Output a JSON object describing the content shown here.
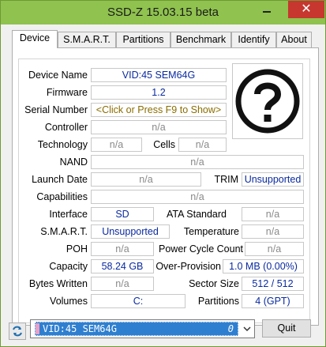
{
  "window": {
    "title": "SSD-Z 15.03.15 beta",
    "close_glyph": "✕",
    "accent": "#8fc24e",
    "close_color": "#c7372f"
  },
  "tabs": [
    {
      "label": "Device",
      "active": true
    },
    {
      "label": "S.M.A.R.T.",
      "active": false
    },
    {
      "label": "Partitions",
      "active": false
    },
    {
      "label": "Benchmark",
      "active": false
    },
    {
      "label": "Identify",
      "active": false
    },
    {
      "label": "About",
      "active": false
    }
  ],
  "device": {
    "device_name": {
      "label": "Device Name",
      "value": "VID:45 SEM64G"
    },
    "firmware": {
      "label": "Firmware",
      "value": "1.2"
    },
    "serial_number": {
      "label": "Serial Number",
      "value": "<Click or Press F9 to Show>"
    },
    "controller": {
      "label": "Controller",
      "value": "n/a"
    },
    "technology": {
      "label": "Technology",
      "value": "n/a"
    },
    "cells": {
      "label": "Cells",
      "value": "n/a"
    },
    "nand": {
      "label": "NAND",
      "value": "n/a"
    },
    "launch_date": {
      "label": "Launch Date",
      "value": "n/a"
    },
    "trim": {
      "label": "TRIM",
      "value": "Unsupported"
    },
    "capabilities": {
      "label": "Capabilities",
      "value": "n/a"
    },
    "interface": {
      "label": "Interface",
      "value": "SD"
    },
    "ata_standard": {
      "label": "ATA Standard",
      "value": "n/a"
    },
    "smart": {
      "label": "S.M.A.R.T.",
      "value": "Unsupported"
    },
    "temperature": {
      "label": "Temperature",
      "value": "n/a"
    },
    "poh": {
      "label": "POH",
      "value": "n/a"
    },
    "power_cycle_count": {
      "label": "Power Cycle Count",
      "value": "n/a"
    },
    "capacity": {
      "label": "Capacity",
      "value": "58.24 GB"
    },
    "over_provision": {
      "label": "Over-Provision",
      "value": "1.0 MB (0.00%)"
    },
    "bytes_written": {
      "label": "Bytes Written",
      "value": "n/a"
    },
    "sector_size": {
      "label": "Sector Size",
      "value": "512 / 512"
    },
    "volumes": {
      "label": "Volumes",
      "value": "C:"
    },
    "partitions": {
      "label": "Partitions",
      "value": "4 (GPT)"
    },
    "device_image_icon": "question-mark-icon"
  },
  "bottom": {
    "drive_select": {
      "value": "VID:45 SEM64G",
      "index": "0"
    },
    "quit_label": "Quit",
    "refresh_icon": "refresh-icon"
  }
}
